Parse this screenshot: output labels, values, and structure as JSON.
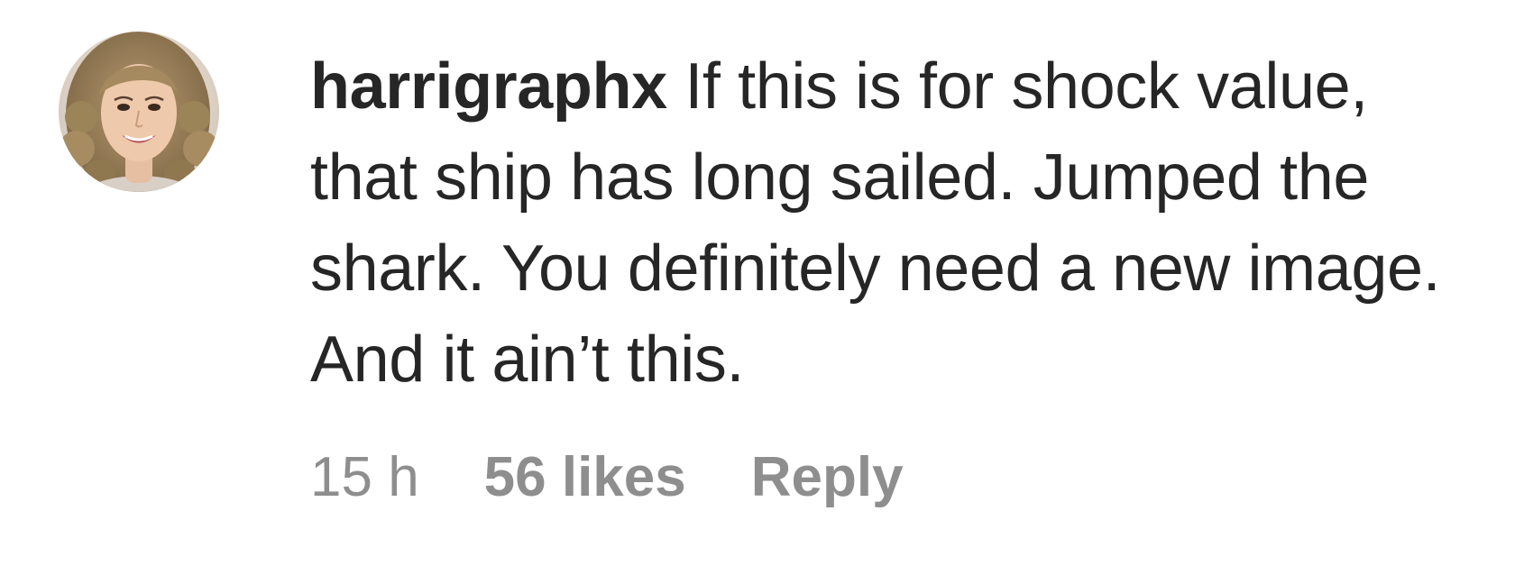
{
  "comment": {
    "username": "harrigraphx",
    "text": "If this is for shock value, that ship has long sailed. Jumped the shark. You definitely need a new image. And it ain’t this.",
    "time": "15 h",
    "likes": "56 likes",
    "reply_label": "Reply"
  },
  "colors": {
    "text": "#262626",
    "meta": "#8e8e8e"
  }
}
